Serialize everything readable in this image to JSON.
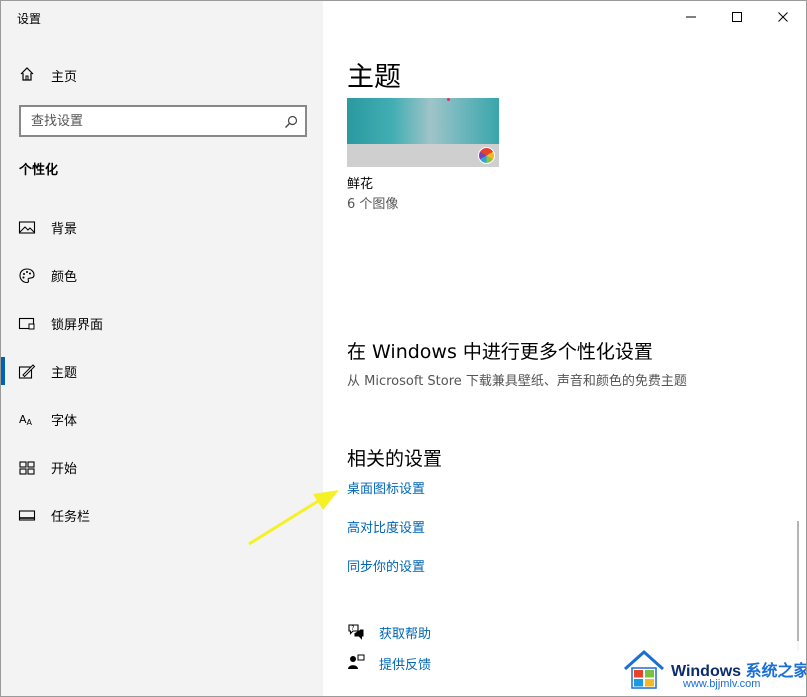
{
  "window": {
    "title": "设置"
  },
  "sidebar": {
    "home_label": "主页",
    "search_placeholder": "查找设置",
    "section_title": "个性化",
    "items": [
      {
        "label": "背景"
      },
      {
        "label": "颜色"
      },
      {
        "label": "锁屏界面"
      },
      {
        "label": "主题",
        "selected": true
      },
      {
        "label": "字体"
      },
      {
        "label": "开始"
      },
      {
        "label": "任务栏"
      }
    ]
  },
  "main": {
    "page_title": "主题",
    "theme": {
      "name": "鲜花",
      "count": "6 个图像"
    },
    "more": {
      "title": "在 Windows 中进行更多个性化设置",
      "description": "从 Microsoft Store 下载兼具壁纸、声音和颜色的免费主题"
    },
    "related": {
      "title": "相关的设置",
      "links": [
        "桌面图标设置",
        "高对比度设置",
        "同步你的设置"
      ]
    },
    "help": {
      "get_help": "获取帮助",
      "feedback": "提供反馈"
    }
  },
  "watermark": {
    "brand": "Windows",
    "brand_suffix": "系统之家",
    "url": "www.bjjmlv.com"
  },
  "colors": {
    "accent": "#0063b1",
    "link": "#0066b4",
    "sidebar_bg": "#f3f3f3",
    "arrow": "#f5f125"
  }
}
